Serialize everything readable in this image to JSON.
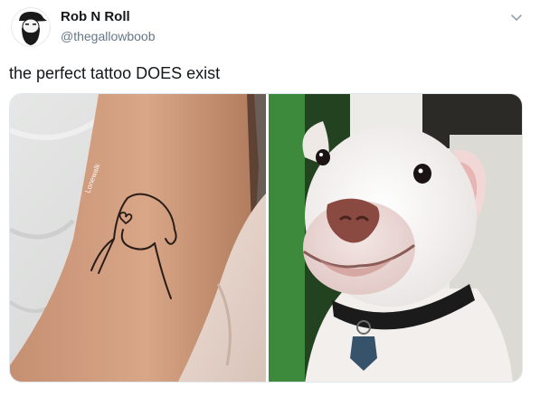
{
  "tweet": {
    "display_name": "Rob N Roll",
    "handle": "@thegallowboob",
    "text": "the perfect tattoo DOES exist"
  },
  "media": {
    "left_photo": {
      "subject": "tattoo-arm-photo",
      "watermark": "Lonewalk"
    },
    "right_photo": {
      "subject": "smiling-dog-photo"
    }
  },
  "colors": {
    "name": "#14171a",
    "handle": "#657786",
    "chevron": "#8899a6",
    "border": "#e1e8ed"
  },
  "icons": {
    "more_menu": "chevron-down-icon",
    "avatar": "bearded-avatar-icon"
  }
}
